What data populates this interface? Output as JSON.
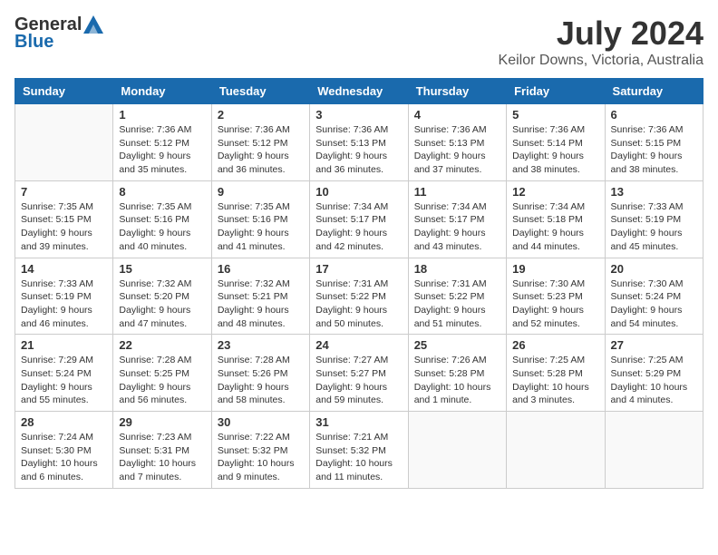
{
  "header": {
    "logo_general": "General",
    "logo_blue": "Blue",
    "title": "July 2024",
    "subtitle": "Keilor Downs, Victoria, Australia"
  },
  "weekdays": [
    "Sunday",
    "Monday",
    "Tuesday",
    "Wednesday",
    "Thursday",
    "Friday",
    "Saturday"
  ],
  "weeks": [
    [
      {
        "day": "",
        "info": ""
      },
      {
        "day": "1",
        "info": "Sunrise: 7:36 AM\nSunset: 5:12 PM\nDaylight: 9 hours\nand 35 minutes."
      },
      {
        "day": "2",
        "info": "Sunrise: 7:36 AM\nSunset: 5:12 PM\nDaylight: 9 hours\nand 36 minutes."
      },
      {
        "day": "3",
        "info": "Sunrise: 7:36 AM\nSunset: 5:13 PM\nDaylight: 9 hours\nand 36 minutes."
      },
      {
        "day": "4",
        "info": "Sunrise: 7:36 AM\nSunset: 5:13 PM\nDaylight: 9 hours\nand 37 minutes."
      },
      {
        "day": "5",
        "info": "Sunrise: 7:36 AM\nSunset: 5:14 PM\nDaylight: 9 hours\nand 38 minutes."
      },
      {
        "day": "6",
        "info": "Sunrise: 7:36 AM\nSunset: 5:15 PM\nDaylight: 9 hours\nand 38 minutes."
      }
    ],
    [
      {
        "day": "7",
        "info": "Sunrise: 7:35 AM\nSunset: 5:15 PM\nDaylight: 9 hours\nand 39 minutes."
      },
      {
        "day": "8",
        "info": "Sunrise: 7:35 AM\nSunset: 5:16 PM\nDaylight: 9 hours\nand 40 minutes."
      },
      {
        "day": "9",
        "info": "Sunrise: 7:35 AM\nSunset: 5:16 PM\nDaylight: 9 hours\nand 41 minutes."
      },
      {
        "day": "10",
        "info": "Sunrise: 7:34 AM\nSunset: 5:17 PM\nDaylight: 9 hours\nand 42 minutes."
      },
      {
        "day": "11",
        "info": "Sunrise: 7:34 AM\nSunset: 5:17 PM\nDaylight: 9 hours\nand 43 minutes."
      },
      {
        "day": "12",
        "info": "Sunrise: 7:34 AM\nSunset: 5:18 PM\nDaylight: 9 hours\nand 44 minutes."
      },
      {
        "day": "13",
        "info": "Sunrise: 7:33 AM\nSunset: 5:19 PM\nDaylight: 9 hours\nand 45 minutes."
      }
    ],
    [
      {
        "day": "14",
        "info": "Sunrise: 7:33 AM\nSunset: 5:19 PM\nDaylight: 9 hours\nand 46 minutes."
      },
      {
        "day": "15",
        "info": "Sunrise: 7:32 AM\nSunset: 5:20 PM\nDaylight: 9 hours\nand 47 minutes."
      },
      {
        "day": "16",
        "info": "Sunrise: 7:32 AM\nSunset: 5:21 PM\nDaylight: 9 hours\nand 48 minutes."
      },
      {
        "day": "17",
        "info": "Sunrise: 7:31 AM\nSunset: 5:22 PM\nDaylight: 9 hours\nand 50 minutes."
      },
      {
        "day": "18",
        "info": "Sunrise: 7:31 AM\nSunset: 5:22 PM\nDaylight: 9 hours\nand 51 minutes."
      },
      {
        "day": "19",
        "info": "Sunrise: 7:30 AM\nSunset: 5:23 PM\nDaylight: 9 hours\nand 52 minutes."
      },
      {
        "day": "20",
        "info": "Sunrise: 7:30 AM\nSunset: 5:24 PM\nDaylight: 9 hours\nand 54 minutes."
      }
    ],
    [
      {
        "day": "21",
        "info": "Sunrise: 7:29 AM\nSunset: 5:24 PM\nDaylight: 9 hours\nand 55 minutes."
      },
      {
        "day": "22",
        "info": "Sunrise: 7:28 AM\nSunset: 5:25 PM\nDaylight: 9 hours\nand 56 minutes."
      },
      {
        "day": "23",
        "info": "Sunrise: 7:28 AM\nSunset: 5:26 PM\nDaylight: 9 hours\nand 58 minutes."
      },
      {
        "day": "24",
        "info": "Sunrise: 7:27 AM\nSunset: 5:27 PM\nDaylight: 9 hours\nand 59 minutes."
      },
      {
        "day": "25",
        "info": "Sunrise: 7:26 AM\nSunset: 5:28 PM\nDaylight: 10 hours\nand 1 minute."
      },
      {
        "day": "26",
        "info": "Sunrise: 7:25 AM\nSunset: 5:28 PM\nDaylight: 10 hours\nand 3 minutes."
      },
      {
        "day": "27",
        "info": "Sunrise: 7:25 AM\nSunset: 5:29 PM\nDaylight: 10 hours\nand 4 minutes."
      }
    ],
    [
      {
        "day": "28",
        "info": "Sunrise: 7:24 AM\nSunset: 5:30 PM\nDaylight: 10 hours\nand 6 minutes."
      },
      {
        "day": "29",
        "info": "Sunrise: 7:23 AM\nSunset: 5:31 PM\nDaylight: 10 hours\nand 7 minutes."
      },
      {
        "day": "30",
        "info": "Sunrise: 7:22 AM\nSunset: 5:32 PM\nDaylight: 10 hours\nand 9 minutes."
      },
      {
        "day": "31",
        "info": "Sunrise: 7:21 AM\nSunset: 5:32 PM\nDaylight: 10 hours\nand 11 minutes."
      },
      {
        "day": "",
        "info": ""
      },
      {
        "day": "",
        "info": ""
      },
      {
        "day": "",
        "info": ""
      }
    ]
  ]
}
